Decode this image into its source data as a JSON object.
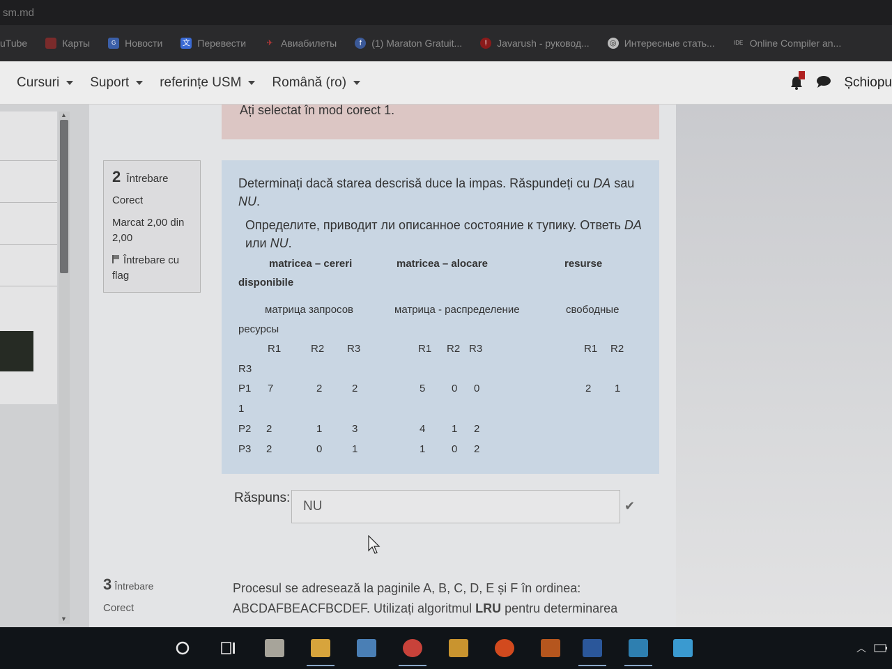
{
  "browser": {
    "title_fragment": "sm.md",
    "bookmarks": [
      {
        "label": "uTube",
        "icon": "youtube-icon"
      },
      {
        "label": "Карты",
        "icon": "maps-icon"
      },
      {
        "label": "Новости",
        "icon": "news-icon"
      },
      {
        "label": "Перевести",
        "icon": "translate-icon"
      },
      {
        "label": "Авиабилеты",
        "icon": "plane-icon"
      },
      {
        "label": "(1) Maraton Gratuit...",
        "icon": "facebook-icon"
      },
      {
        "label": "Javarush - руковод...",
        "icon": "javarush-icon"
      },
      {
        "label": "Интересные стать...",
        "icon": "globe-icon"
      },
      {
        "label": "Online Compiler an...",
        "icon": "ide-icon"
      }
    ]
  },
  "navbar": {
    "items": [
      "Cursuri",
      "Suport",
      "referințe USM",
      "Română ‎(ro)‎"
    ],
    "user": "Șchiopu"
  },
  "previous_feedback": "Ați selectat în mod corect 1.",
  "question2": {
    "number": "2",
    "word": "Întrebare",
    "status": "Corect",
    "mark": "Marcat 2,00 din 2,00",
    "flag_label": "Întrebare cu flag",
    "text_ro_before": "Determinați dacă starea descrisă duce la impas. Răspundeți cu ",
    "text_ro_da": "DA",
    "text_ro_mid": " sau ",
    "text_ro_nu": "NU",
    "text_ro_end": ".",
    "text_ru_before": "Определите, приводит ли описанное состояние к тупику. Ответь ",
    "text_ru_da": "DA",
    "text_ru_mid": " или ",
    "text_ru_nu": "NU",
    "text_ru_end": ".",
    "headers": {
      "requests": "matricea – cereri",
      "allocation": "matricea – alocare",
      "resources": "resurse",
      "available": "disponibile"
    },
    "headers_ru": {
      "requests": "матрица запросов",
      "allocation": "матрица - распределение",
      "free": "свободные",
      "resources": "ресурсы"
    },
    "resource_labels": [
      "R1",
      "R2",
      "R3"
    ],
    "rows": [
      {
        "p": "P1",
        "req": [
          "7",
          "2",
          "2"
        ],
        "alloc": [
          "5",
          "0",
          "0"
        ],
        "avail": [
          "2",
          "1",
          "1"
        ]
      },
      {
        "p": "P2",
        "req": [
          "2",
          "1",
          "3"
        ],
        "alloc": [
          "4",
          "1",
          "2"
        ]
      },
      {
        "p": "P3",
        "req": [
          "2",
          "0",
          "1"
        ],
        "alloc": [
          "1",
          "0",
          "2"
        ]
      }
    ],
    "answer_label": "Răspuns:",
    "answer_value": "NU"
  },
  "question3": {
    "number": "3",
    "word": "Întrebare",
    "status": "Corect",
    "text_line1": "Procesul se adresează la paginile A, B, C, D, E și F în ordinea:",
    "text_line2_before": "ABCDAFBEACFBCDEF. Utilizați algoritmul ",
    "text_line2_bold": "LRU",
    "text_line2_after": " pentru determinarea"
  },
  "colors": {
    "question_bg": "#c9d6e3",
    "feedback_bg": "#dcc6c4",
    "navbar_bg": "#ededed",
    "taskbar_bg": "#101418"
  }
}
